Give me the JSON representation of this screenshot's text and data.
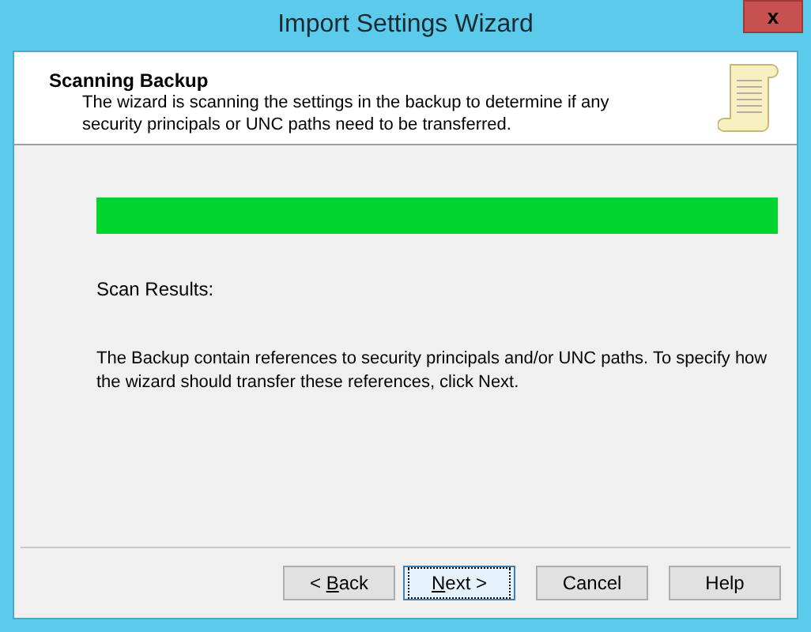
{
  "window": {
    "title": "Import Settings Wizard",
    "close": "x"
  },
  "header": {
    "title": "Scanning Backup",
    "description": "The wizard is scanning the settings in the backup to determine if any security principals or UNC paths need to be transferred."
  },
  "progress": {
    "level": 1
  },
  "scan_results_label": "Scan Results:",
  "message": "The Backup contain references to security principals and/or UNC paths. To specify how the wizard should transfer these references, click Next.",
  "buttons": [
    {
      "before": "< ",
      "key": "B",
      "after": "ack",
      "default": false
    },
    {
      "key": "N",
      "after": "ext >",
      "default": true
    },
    {
      "before": "Cancel",
      "default": false
    },
    {
      "before": "Help",
      "default": false
    }
  ]
}
